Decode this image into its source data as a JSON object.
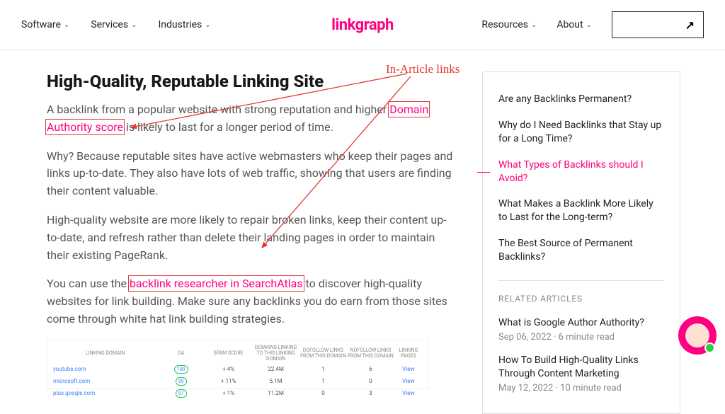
{
  "nav": {
    "left": [
      "Software",
      "Services",
      "Industries"
    ],
    "right": [
      "Resources",
      "About"
    ]
  },
  "logo": "linkgraph",
  "cta_glyph": "↗",
  "annotation": "In-Article links",
  "article": {
    "heading": "High-Quality, Reputable Linking Site",
    "p1a": "A backlink from a popular website with strong reputation and higher ",
    "link1": "Domain Authority score",
    "p1b": " is likely to last for a longer period of time.",
    "p2": "Why? Because reputable sites have active webmasters who keep their pages and links up-to-date. They also have lots of web traffic, showing that users are finding their content valuable.",
    "p3": "High-quality website are more likely to repair broken links, keep their content up-to-date, and refresh rather than delete their landing pages in order to maintain their existing PageRank.",
    "p4a": "You can use the ",
    "link2": "backlink researcher in SearchAtlas",
    "p4b": " to discover high-quality websites for link building. Make sure any backlinks you do earn from those sites come through white hat link building strategies."
  },
  "screenshot": {
    "headers": [
      "LINKING DOMAIN",
      "DA",
      "SPAM SCORE",
      "DOMAINS LINKING TO THIS LINKING DOMAIN",
      "DOFOLLOW LINKS FROM THIS DOMAIN",
      "NOFOLLOW LINKS FROM THIS DOMAIN",
      "LINKING PAGES"
    ],
    "rows": [
      {
        "domain": "youtube.com",
        "da": "100",
        "spam": "+ 4%",
        "dltd": "22.4M",
        "df": "1",
        "nf": "6",
        "act": "View"
      },
      {
        "domain": "microsoft.com",
        "da": "99",
        "spam": "+ 11%",
        "dltd": "5.1M",
        "df": "1",
        "nf": "0",
        "act": "View"
      },
      {
        "domain": "plus.google.com",
        "da": "97",
        "spam": "+ 1%",
        "dltd": "11.2M",
        "df": "0",
        "nf": "3",
        "act": "View"
      }
    ]
  },
  "toc": [
    {
      "t": "Are any Backlinks Permanent?",
      "a": 0
    },
    {
      "t": "Why do I Need Backlinks that Stay up for a Long Time?",
      "a": 0
    },
    {
      "t": "What Types of Backlinks should I Avoid?",
      "a": 1
    },
    {
      "t": "What Makes a Backlink More Likely to Last for the Long-term?",
      "a": 0
    },
    {
      "t": "The Best Source of Permanent Backlinks?",
      "a": 0
    }
  ],
  "related_heading": "RELATED ARTICLES",
  "related": [
    {
      "t": "What is Google Author Authority?",
      "m": "Sep 06, 2022 · 6 minute read"
    },
    {
      "t": "How To Build High-Quality Links Through Content Marketing",
      "m": "May 12, 2022 · 10 minute read"
    }
  ]
}
